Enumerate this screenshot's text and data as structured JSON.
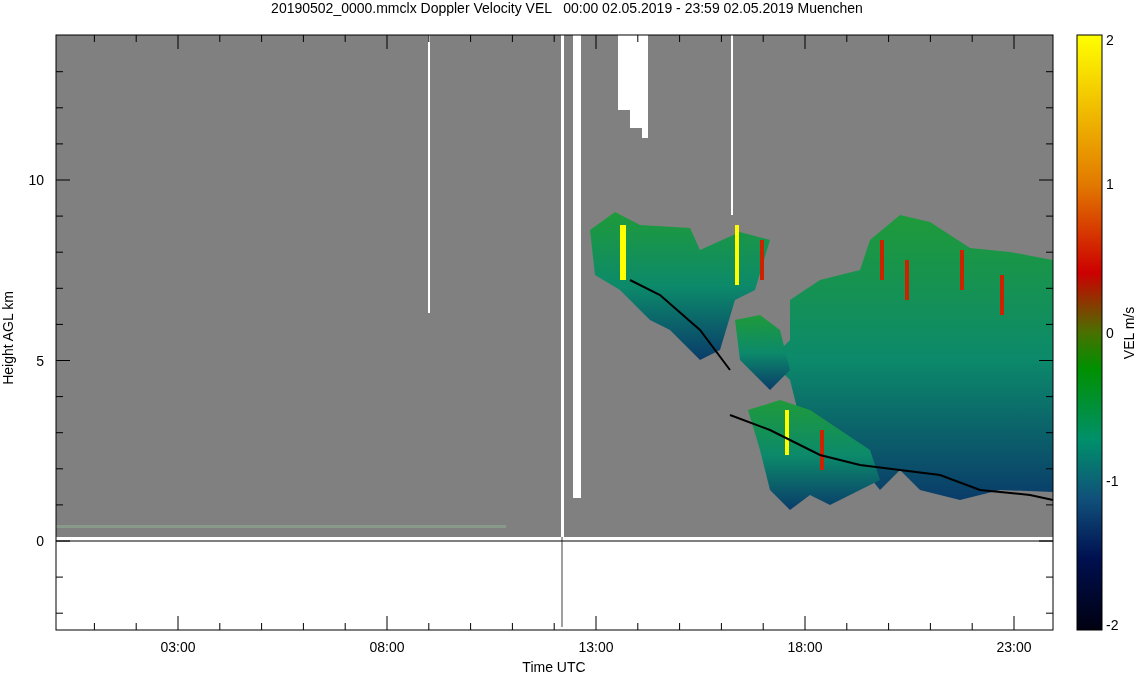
{
  "title": "20190502_0000.mmclx Doppler Velocity VEL   00:00 02.05.2019 - 23:59 02.05.2019 Muenchen",
  "y_axis": {
    "label": "Height AGL km",
    "ticks": [
      "10",
      "5",
      "0"
    ]
  },
  "x_axis": {
    "label": "Time UTC",
    "ticks": [
      "03:00",
      "08:00",
      "13:00",
      "18:00",
      "23:00"
    ]
  },
  "colorbar": {
    "label": "VEL m/s",
    "ticks": [
      "2",
      "1",
      "0",
      "-1",
      "-2"
    ]
  }
}
